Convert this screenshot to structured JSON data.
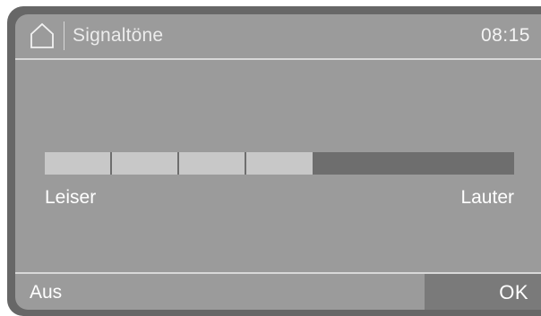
{
  "header": {
    "title": "Signaltöne",
    "time": "08:15",
    "home_icon": "home-icon"
  },
  "volume": {
    "min_label": "Leiser",
    "max_label": "Lauter",
    "level": 4,
    "max_level": 7
  },
  "footer": {
    "off_label": "Aus",
    "ok_label": "OK"
  },
  "colors": {
    "screen_bg": "#9b9b9b",
    "frame": "#676767",
    "segment_on": "#c8c8c8",
    "segment_off": "#6e6e6e",
    "ok_bg": "#7a7a7a"
  }
}
